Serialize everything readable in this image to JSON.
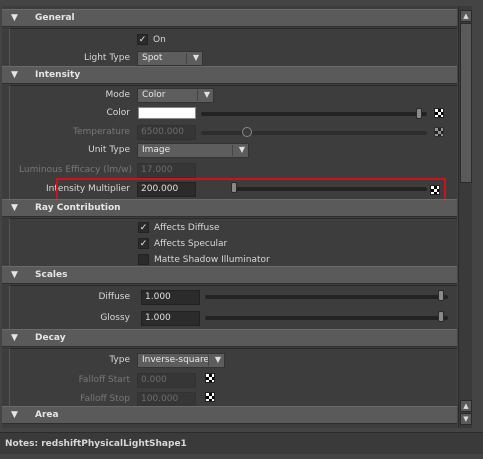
{
  "sections": {
    "general": {
      "title": "General"
    },
    "intensity": {
      "title": "Intensity"
    },
    "ray_contribution": {
      "title": "Ray Contribution"
    },
    "scales": {
      "title": "Scales"
    },
    "decay": {
      "title": "Decay"
    },
    "area": {
      "title": "Area"
    }
  },
  "general": {
    "on_checked": true,
    "on_label": "On",
    "light_type_label": "Light Type",
    "light_type_value": "Spot"
  },
  "intensity": {
    "mode_label": "Mode",
    "mode_value": "Color",
    "color_label": "Color",
    "color_value": "#ffffff",
    "temperature_label": "Temperature",
    "temperature_value": "6500.000",
    "unit_type_label": "Unit Type",
    "unit_type_value": "Image",
    "luminous_efficacy_label": "Luminous Efficacy (lm/w)",
    "luminous_efficacy_value": "17.000",
    "multiplier_label": "Intensity Multiplier",
    "multiplier_value": "200.000"
  },
  "ray_contribution": {
    "affects_diffuse_label": "Affects Diffuse",
    "affects_diffuse_checked": true,
    "affects_specular_label": "Affects Specular",
    "affects_specular_checked": true,
    "matte_shadow_label": "Matte Shadow Illuminator",
    "matte_shadow_checked": false
  },
  "scales": {
    "diffuse_label": "Diffuse",
    "diffuse_value": "1.000",
    "glossy_label": "Glossy",
    "glossy_value": "1.000"
  },
  "decay": {
    "type_label": "Type",
    "type_value": "Inverse-square",
    "falloff_start_label": "Falloff Start",
    "falloff_start_value": "0.000",
    "falloff_stop_label": "Falloff Stop",
    "falloff_stop_value": "100.000"
  },
  "icons": {
    "expand": "▼",
    "dropdown": "▼",
    "check": "✓",
    "scroll_up": "▲",
    "scroll_down": "▼"
  },
  "notes": {
    "text": "Notes:  redshiftPhysicalLightShape1"
  },
  "colors": {
    "highlight": "#d0101a"
  }
}
